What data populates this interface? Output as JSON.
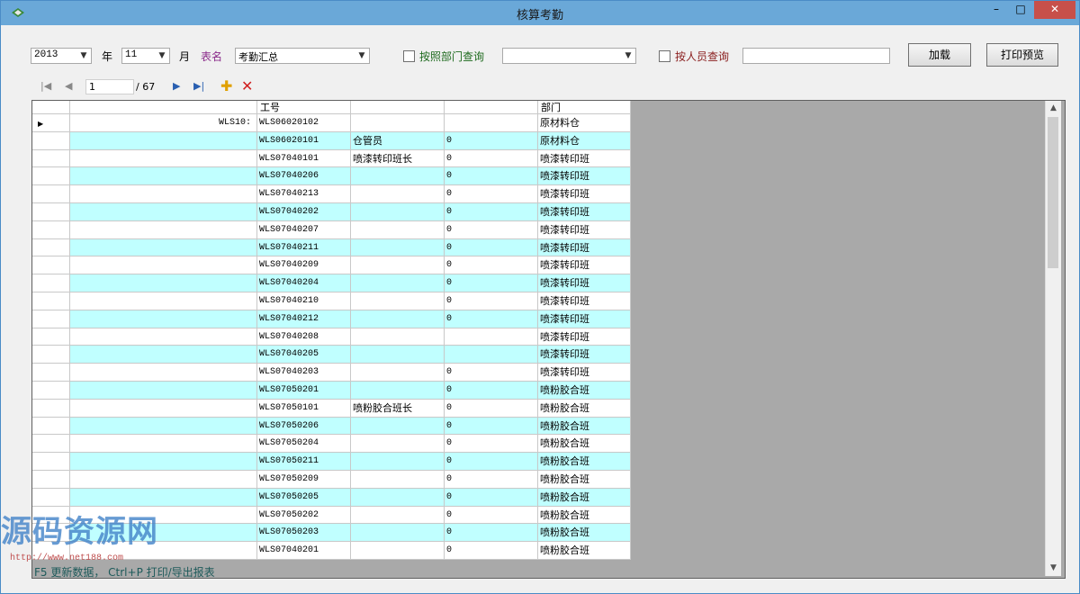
{
  "window": {
    "title": "核算考勤",
    "min": "–",
    "max": "□",
    "close": "✕"
  },
  "filters": {
    "year": "2013",
    "year_label": "年",
    "month": "11",
    "month_label": "月",
    "table_label": "表名",
    "table_value": "考勤汇总",
    "dept_query_label": "按照部门查询",
    "dept_value": "",
    "person_query_label": "按人员查询",
    "person_value": "",
    "load_button": "加载",
    "print_button": "打印预览"
  },
  "navigator": {
    "position": "1",
    "total": "/ 67"
  },
  "grid": {
    "columns": [
      "",
      "工号",
      "",
      "",
      "部门"
    ],
    "rows": [
      {
        "name": "WLS10:",
        "id": "WLS06020102",
        "post": "",
        "num": "",
        "dept": "原材料仓"
      },
      {
        "name": "",
        "id": "WLS06020101",
        "post": "仓管员",
        "num": "0",
        "dept": "原材料仓"
      },
      {
        "name": "",
        "id": "WLS07040101",
        "post": "喷漆转印班长",
        "num": "0",
        "dept": "喷漆转印班"
      },
      {
        "name": "",
        "id": "WLS07040206",
        "post": "",
        "num": "0",
        "dept": "喷漆转印班"
      },
      {
        "name": "",
        "id": "WLS07040213",
        "post": "",
        "num": "0",
        "dept": "喷漆转印班"
      },
      {
        "name": "",
        "id": "WLS07040202",
        "post": "",
        "num": "0",
        "dept": "喷漆转印班"
      },
      {
        "name": "",
        "id": "WLS07040207",
        "post": "",
        "num": "0",
        "dept": "喷漆转印班"
      },
      {
        "name": "",
        "id": "WLS07040211",
        "post": "",
        "num": "0",
        "dept": "喷漆转印班"
      },
      {
        "name": "",
        "id": "WLS07040209",
        "post": "",
        "num": "0",
        "dept": "喷漆转印班"
      },
      {
        "name": "",
        "id": "WLS07040204",
        "post": "",
        "num": "0",
        "dept": "喷漆转印班"
      },
      {
        "name": "",
        "id": "WLS07040210",
        "post": "",
        "num": "0",
        "dept": "喷漆转印班"
      },
      {
        "name": "",
        "id": "WLS07040212",
        "post": "",
        "num": "0",
        "dept": "喷漆转印班"
      },
      {
        "name": "",
        "id": "WLS07040208",
        "post": "",
        "num": "",
        "dept": "喷漆转印班"
      },
      {
        "name": "",
        "id": "WLS07040205",
        "post": "",
        "num": "",
        "dept": "喷漆转印班"
      },
      {
        "name": "",
        "id": "WLS07040203",
        "post": "",
        "num": "0",
        "dept": "喷漆转印班"
      },
      {
        "name": "",
        "id": "WLS07050201",
        "post": "",
        "num": "0",
        "dept": "喷粉胶合班"
      },
      {
        "name": "",
        "id": "WLS07050101",
        "post": "喷粉胶合班长",
        "num": "0",
        "dept": "喷粉胶合班"
      },
      {
        "name": "",
        "id": "WLS07050206",
        "post": "",
        "num": "0",
        "dept": "喷粉胶合班"
      },
      {
        "name": "",
        "id": "WLS07050204",
        "post": "",
        "num": "0",
        "dept": "喷粉胶合班"
      },
      {
        "name": "",
        "id": "WLS07050211",
        "post": "",
        "num": "0",
        "dept": "喷粉胶合班"
      },
      {
        "name": "",
        "id": "WLS07050209",
        "post": "",
        "num": "0",
        "dept": "喷粉胶合班"
      },
      {
        "name": "",
        "id": "WLS07050205",
        "post": "",
        "num": "0",
        "dept": "喷粉胶合班"
      },
      {
        "name": "",
        "id": "WLS07050202",
        "post": "",
        "num": "0",
        "dept": "喷粉胶合班"
      },
      {
        "name": "",
        "id": "WLS07050203",
        "post": "",
        "num": "0",
        "dept": "喷粉胶合班"
      },
      {
        "name": "",
        "id": "WLS07040201",
        "post": "",
        "num": "0",
        "dept": "喷粉胶合班"
      }
    ]
  },
  "status": {
    "text": "F5 更新数据， Ctrl+P 打印/导出报表"
  },
  "watermark": {
    "text": "源码资源网",
    "url": "http://www.net188.com"
  },
  "colors": {
    "alt_row": "#c0ffff",
    "titlebar": "#6aa8d8",
    "close": "#c7504a"
  }
}
